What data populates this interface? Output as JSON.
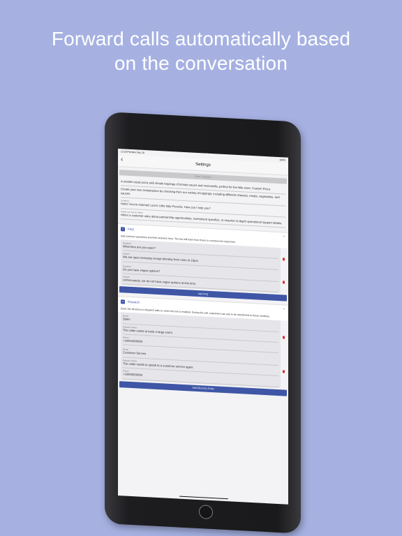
{
  "headline": {
    "line1": "Forward calls automatically based",
    "line2": "on the conversation"
  },
  "status_bar": {
    "time": "12:18 PM",
    "date": "Mon Dec 18",
    "battery": "100%"
  },
  "nav": {
    "title": "Settings"
  },
  "save_label": "Save Changes",
  "top_fields": [
    {
      "label": "",
      "value": "A smaller-sized pizza with simple toppings of tomato sauce and mozzarella, perfect for the little ones. Custom Pizza"
    },
    {
      "label": "",
      "value": "Create your own masterpiece by choosing from our variety of toppings, including different cheeses, meats, vegetables, and sauces."
    },
    {
      "label": "Greeting",
      "value": "Hello! You've reached Luca's Little Italy Pizzeria. How can I help you?"
    },
    {
      "label": "Follow up Human When",
      "value": "When a customer asks about partnership opportunities, investment specifics, or requires in-depth operational support details."
    }
  ],
  "faq": {
    "title": "FAQ",
    "description": "Add common questions and their answers here. The bot will learn from these to construct its responses.",
    "items": [
      {
        "q_label": "Question",
        "question": "What time are you open?",
        "a_label": "Answer",
        "answer": "We are open everyday except Monday from noon to 10pm"
      },
      {
        "q_label": "Question",
        "question": "Do you have vegan options?",
        "a_label": "Answer",
        "answer": "Unfortunately, we do not have vegan options at this time."
      }
    ],
    "add_label": "Add FAQ"
  },
  "dispatch": {
    "title": "Dispatch",
    "description": "Enter the directory to dispatch calls to, when the bot is enabled. During the call, customers can ask to be transferred to these numbers.",
    "items": [
      {
        "name_label": "Name",
        "name": "Sales",
        "when_label": "Dispatch When",
        "when": "The caller wants to book a large event",
        "phone_label": "Phone",
        "phone": "+18004000000"
      },
      {
        "name_label": "Name",
        "name": "Customer Service",
        "when_label": "Dispatch When",
        "when": "The caller needs to speak to a customer service agent",
        "phone_label": "Phone",
        "phone": "+18000000000"
      }
    ],
    "add_label": "Add Directory Entry"
  },
  "colors": {
    "background": "#a6b1e2",
    "accent": "#3f56a6",
    "danger": "#d0312d"
  }
}
